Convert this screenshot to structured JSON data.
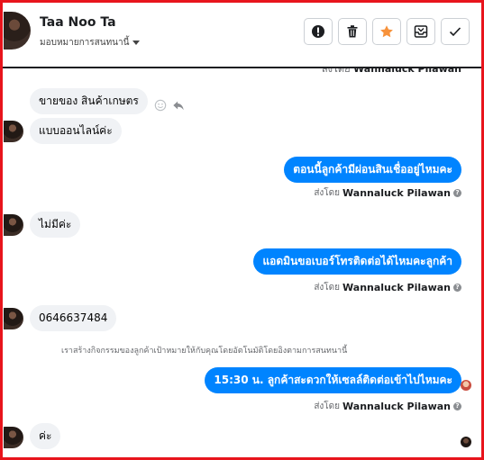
{
  "header": {
    "contact_name": "Taa Noo Ta",
    "assign_label": "มอบหมายการสนทนานี้",
    "actions": [
      "mark-spam",
      "delete",
      "star",
      "move-inbox",
      "mark-done"
    ]
  },
  "colors": {
    "accent": "#0084ff",
    "incoming_bubble": "#f0f2f5",
    "star": "#f7923b",
    "frame": "#e8141c"
  },
  "sender_prefix": "ส่งโดย",
  "agent_name": "Wannaluck Pilawan",
  "messages": [
    {
      "dir": "in",
      "text": "ขายของ สินค้าเกษตร"
    },
    {
      "dir": "in",
      "text": "แบบออนไลน์ค่ะ"
    },
    {
      "dir": "out",
      "text": "ตอนนี้ลูกค้ามีผ่อนสินเชื่ออยู่ไหมคะ"
    },
    {
      "dir": "in",
      "text": "ไม่มีค่ะ"
    },
    {
      "dir": "out",
      "text": "แอดมินขอเบอร์โทรติดต่อได้ไหมคะลูกค้า"
    },
    {
      "dir": "in",
      "text": "0646637484"
    },
    {
      "dir": "out",
      "text": "15:30 น. ลูกค้าสะดวกให้เซลล์ติดต่อเข้าไปไหมคะ"
    },
    {
      "dir": "in",
      "text": "ค่ะ"
    }
  ],
  "system_note": "เราสร้างกิจกรรมของลูกค้าเป้าหมายให้กับคุณโดยอัตโนมัติโดยอิงตามการสนทนานี้"
}
